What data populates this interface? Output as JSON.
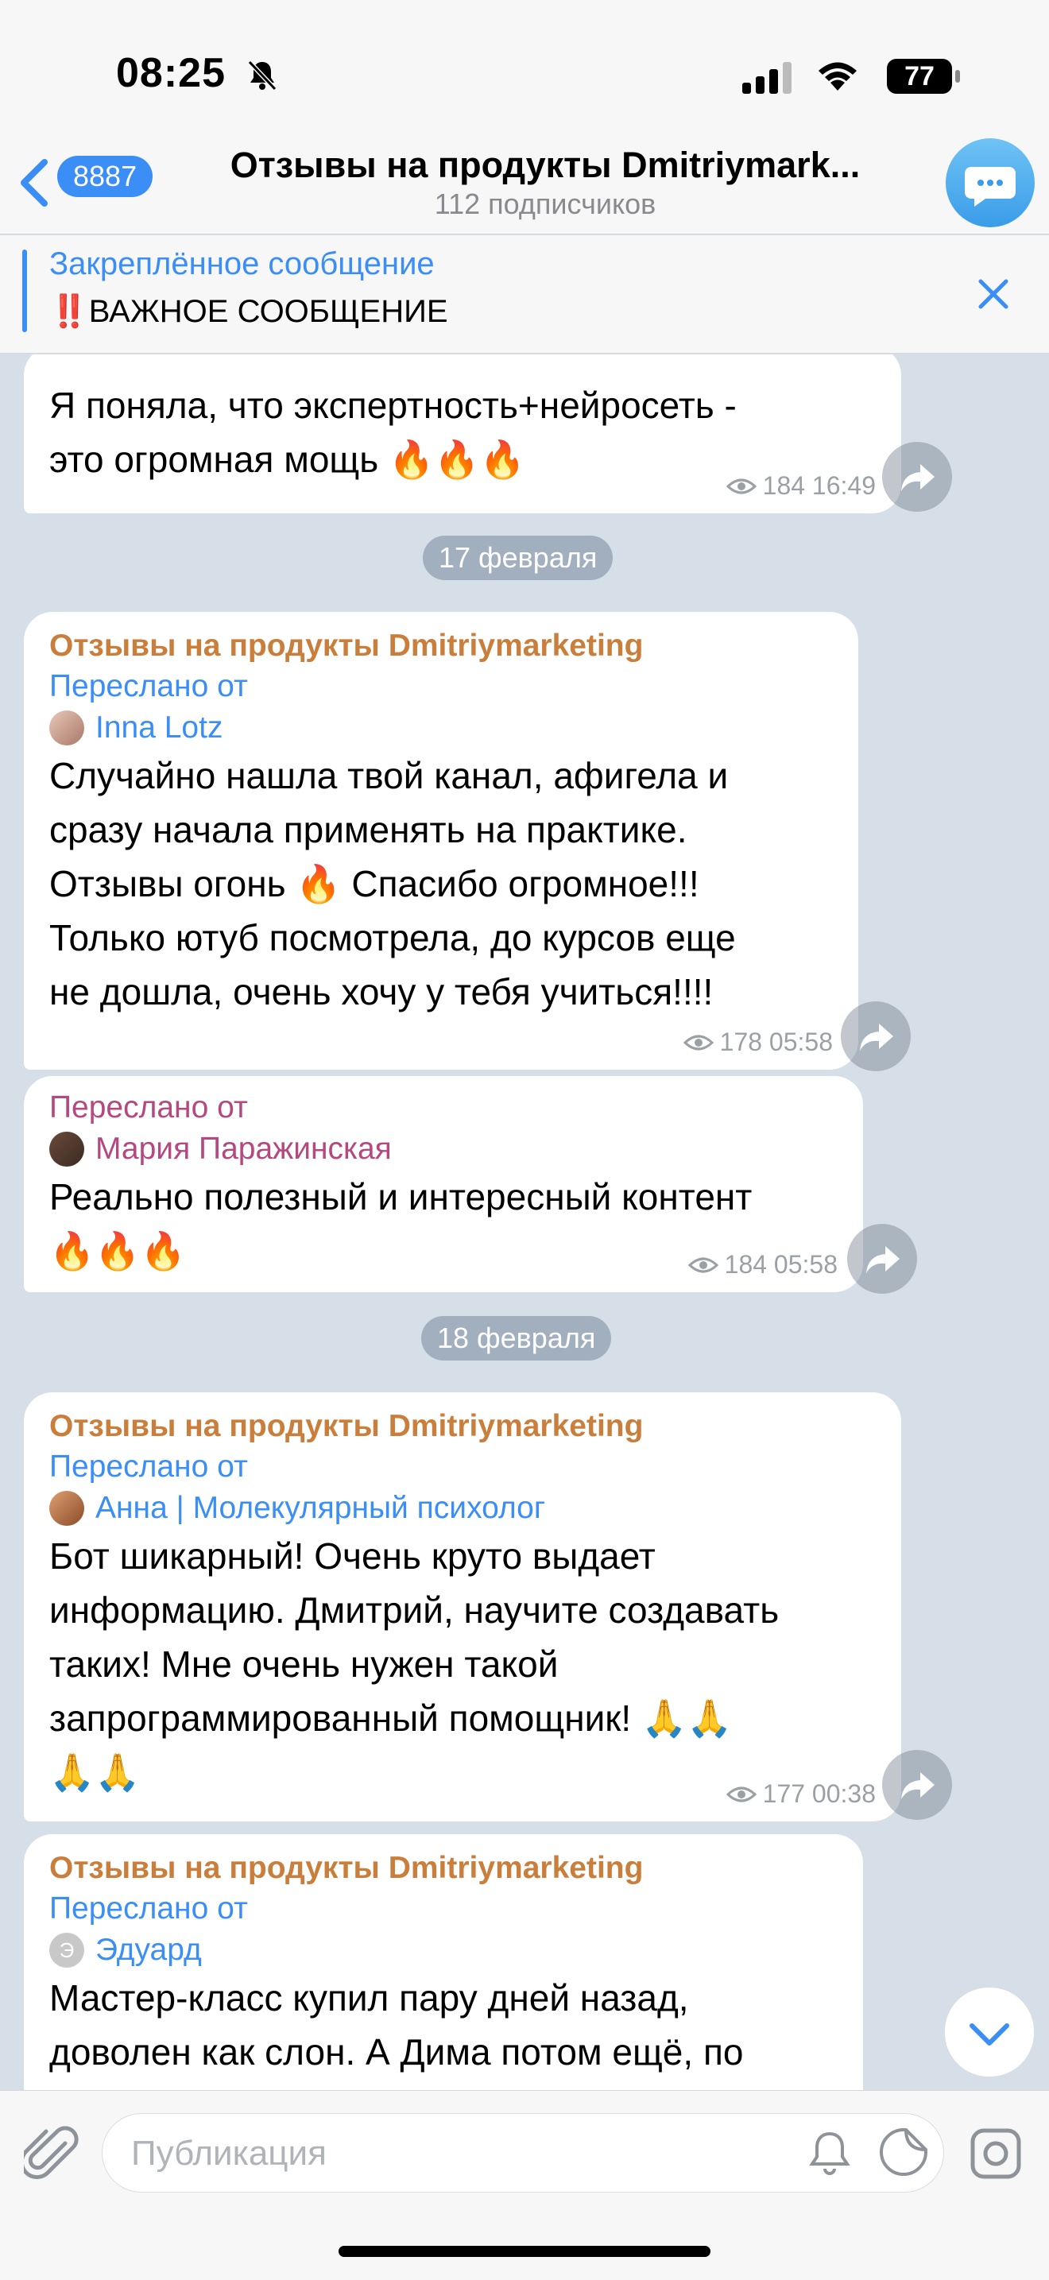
{
  "status": {
    "time": "08:25",
    "battery": "77"
  },
  "header": {
    "back_count": "8887",
    "title": "Отзывы на продукты Dmitriymark...",
    "subtitle": "112 подписчиков"
  },
  "pinned": {
    "title": "Закреплённое сообщение",
    "text": "‼️ВАЖНОЕ СООБЩЕНИЕ"
  },
  "messages": [
    {
      "lines": [
        "Я поняла, что экспертность+нейросеть -",
        "это огромная мощь 🔥🔥🔥"
      ],
      "views": "184",
      "time": "16:49"
    },
    {
      "date": "17 февраля"
    },
    {
      "sender": "Отзывы на продукты Dmitriymarketing",
      "fwd_label": "Переслано от",
      "fwd_name": "Inna Lotz",
      "lines": [
        "Случайно нашла твой канал, афигела и",
        "сразу начала применять на практике.",
        "Отзывы огонь 🔥 Спасибо огромное!!!",
        "Только ютуб посмотрела, до курсов еще",
        "не дошла, очень хочу у тебя учиться!!!!"
      ],
      "views": "178",
      "time": "05:58"
    },
    {
      "fwd_label": "Переслано от",
      "fwd_name": "Мария Паражинская",
      "lines": [
        "Реально полезный и интересный контент",
        "🔥🔥🔥"
      ],
      "views": "184",
      "time": "05:58"
    },
    {
      "date": "18 февраля"
    },
    {
      "sender": "Отзывы на продукты Dmitriymarketing",
      "fwd_label": "Переслано от",
      "fwd_name": "Анна | Молекулярный психолог",
      "lines": [
        "Бот шикарный! Очень круто выдает",
        "информацию. Дмитрий, научите создавать",
        "таких! Мне очень нужен такой",
        "запрограммированный помощник! 🙏🙏",
        "🙏🙏"
      ],
      "views": "177",
      "time": "00:38"
    },
    {
      "sender": "Отзывы на продукты Dmitriymarketing",
      "fwd_label": "Переслано от",
      "fwd_name": "Эдуард",
      "fwd_initial": "Э",
      "lines": [
        "Мастер-класс купил пару дней назад,",
        "доволен как слон. А Дима потом ещё, по"
      ]
    }
  ],
  "input": {
    "placeholder": "Публикация"
  },
  "colors": {
    "accent": "#3a8ef6",
    "channel_name": "#c97f3b",
    "fwd_name_alt": "#b5487f"
  }
}
